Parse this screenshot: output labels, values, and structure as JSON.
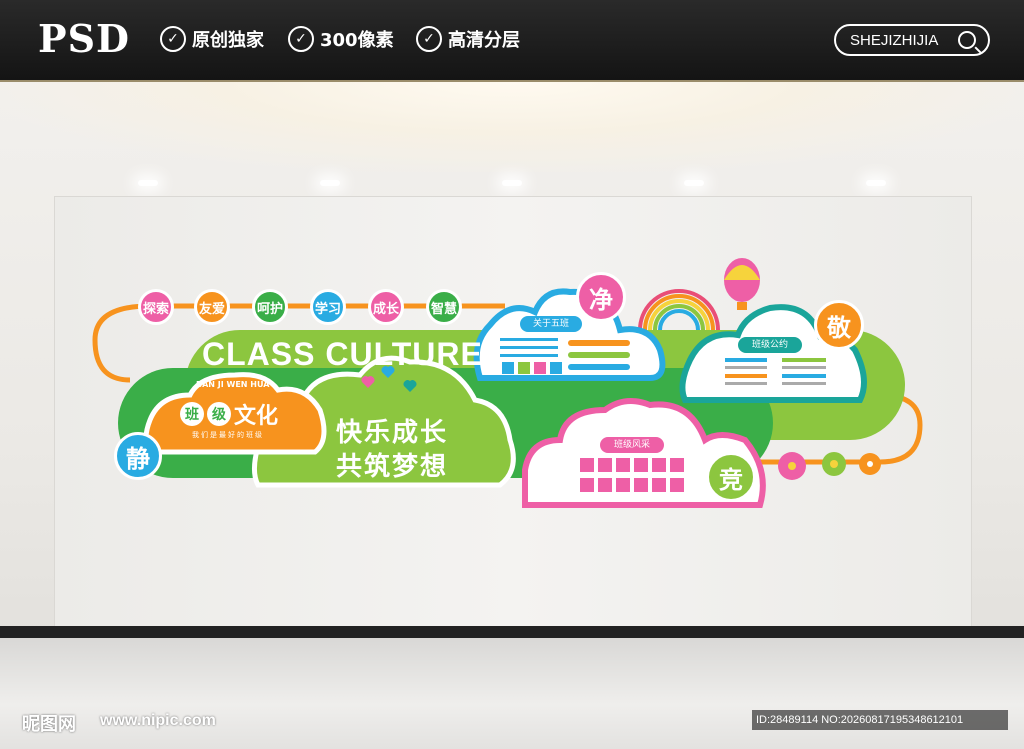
{
  "header": {
    "logo": "PSD",
    "features": [
      "原创独家",
      "300像素",
      "高清分层"
    ],
    "search_text": "SHEJIZHIJIA"
  },
  "wall": {
    "tags": [
      "探索",
      "友爱",
      "呵护",
      "学习",
      "成长",
      "智慧"
    ],
    "title_en": "CLASS CULTURE",
    "subtitle_pinyin": "BAN JI WEN HUA",
    "class_title": [
      "班",
      "级",
      "文化"
    ],
    "class_slogan_small": "我们是最好的班级",
    "main_slogan_1": "快乐成长",
    "main_slogan_2": "共筑梦想",
    "board_about": "关于五班",
    "board_rules": "班级公约",
    "board_style": "班级风采",
    "char_jing_left": "静",
    "char_jing_top": "净",
    "char_jing_right": "敬",
    "char_jing_bottom": "竞"
  },
  "footer": {
    "site_logo": "昵图网",
    "site_url": "www.nipic.com",
    "image_id": "ID:28489114 NO:20260817195348612101"
  },
  "colors": {
    "green": "#8cc63f",
    "dark_green": "#3aae48",
    "orange": "#f7931e",
    "blue": "#29abe2",
    "pink": "#ee5fa6",
    "teal": "#1aa59a"
  }
}
